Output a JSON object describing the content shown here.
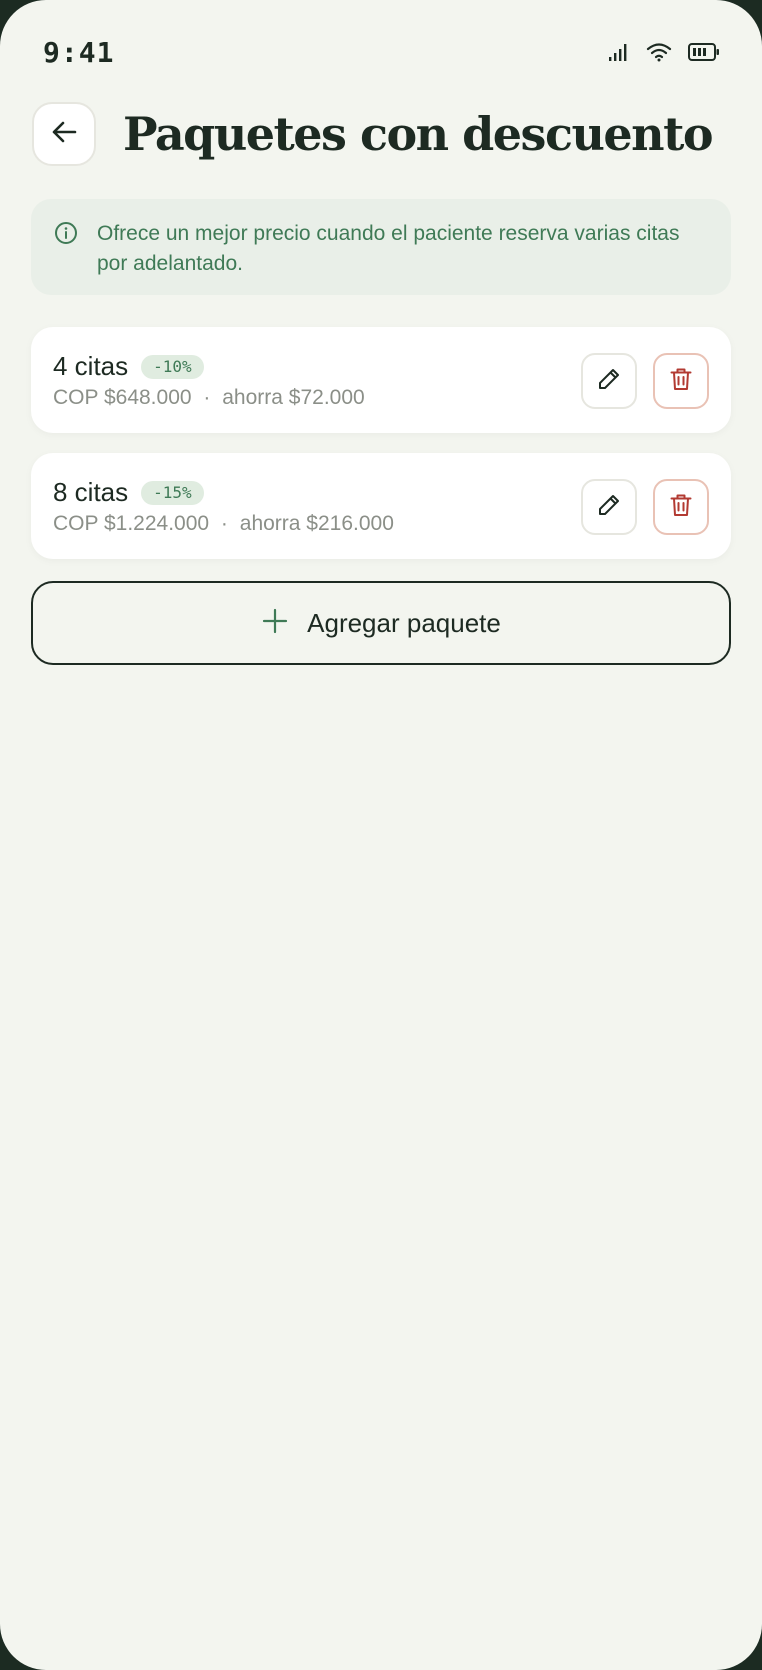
{
  "status_bar": {
    "time": "9:41",
    "icons": [
      "signal-icon",
      "wifi-icon",
      "battery-icon"
    ]
  },
  "header": {
    "back_icon": "arrow-left-icon",
    "title": "Paquetes con descuento"
  },
  "info_banner": {
    "icon": "info-icon",
    "text": "Ofrece un mejor precio cuando el paciente reserva varias citas por adelantado."
  },
  "packages": [
    {
      "title": "4 citas",
      "discount": "-10%",
      "price": "COP $648.000",
      "separator": "·",
      "savings": "ahorra $72.000"
    },
    {
      "title": "8 citas",
      "discount": "-15%",
      "price": "COP $1.224.000",
      "separator": "·",
      "savings": "ahorra $216.000"
    }
  ],
  "add_button": {
    "icon": "plus-icon",
    "label": "Agregar paquete"
  },
  "colors": {
    "background": "#f3f5ef",
    "text_primary": "#1d2a22",
    "accent_green": "#3f7a56",
    "badge_bg": "#e0ece0",
    "banner_bg": "#e9efe8",
    "danger": "#b23a32"
  }
}
